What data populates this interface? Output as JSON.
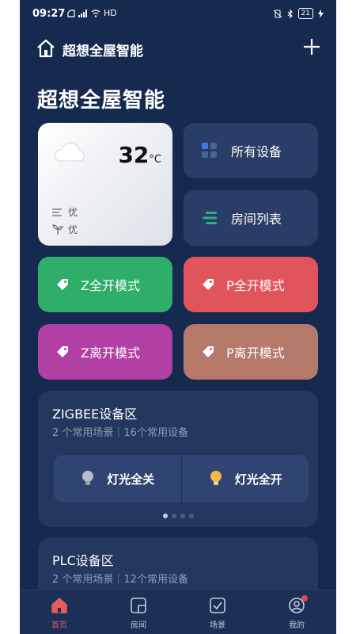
{
  "status_bar": {
    "time": "09:27",
    "network": "HD",
    "battery": "21"
  },
  "header": {
    "title": "超想全屋智能"
  },
  "page_title": "超想全屋智能",
  "weather": {
    "temperature": "32",
    "unit": "°C",
    "air_quality": "优",
    "humidity": "优",
    "icon": "cloud-icon"
  },
  "tiles": {
    "all_devices": "所有设备",
    "room_list": "房间列表"
  },
  "modes": [
    {
      "label": "Z全开模式",
      "color": "#2fae6a"
    },
    {
      "label": "P全开模式",
      "color": "#e0545b"
    },
    {
      "label": "Z离开模式",
      "color": "#b23fa4"
    },
    {
      "label": "P离开模式",
      "color": "#b5796a"
    }
  ],
  "zones": [
    {
      "name": "ZIGBEE设备区",
      "meta": "2 个常用场景｜16个常用设备",
      "scenes": [
        {
          "label": "灯光全关",
          "bulb_color": "#b8bcc4"
        },
        {
          "label": "灯光全开",
          "bulb_color": "#f4b942"
        }
      ]
    },
    {
      "name": "PLC设备区",
      "meta": "2 个常用场景｜12个常用设备"
    }
  ],
  "pager": {
    "current_page": 1,
    "total_pages": 4
  },
  "nav": [
    {
      "label": "首页",
      "icon": "home-icon",
      "active": true
    },
    {
      "label": "房间",
      "icon": "room-icon",
      "active": false
    },
    {
      "label": "场景",
      "icon": "scene-icon",
      "active": false
    },
    {
      "label": "我的",
      "icon": "profile-icon",
      "active": false,
      "badge": true
    }
  ],
  "colors": {
    "background": "#16294f",
    "tile": "#2a3d66",
    "accent": "#e35d5d"
  }
}
